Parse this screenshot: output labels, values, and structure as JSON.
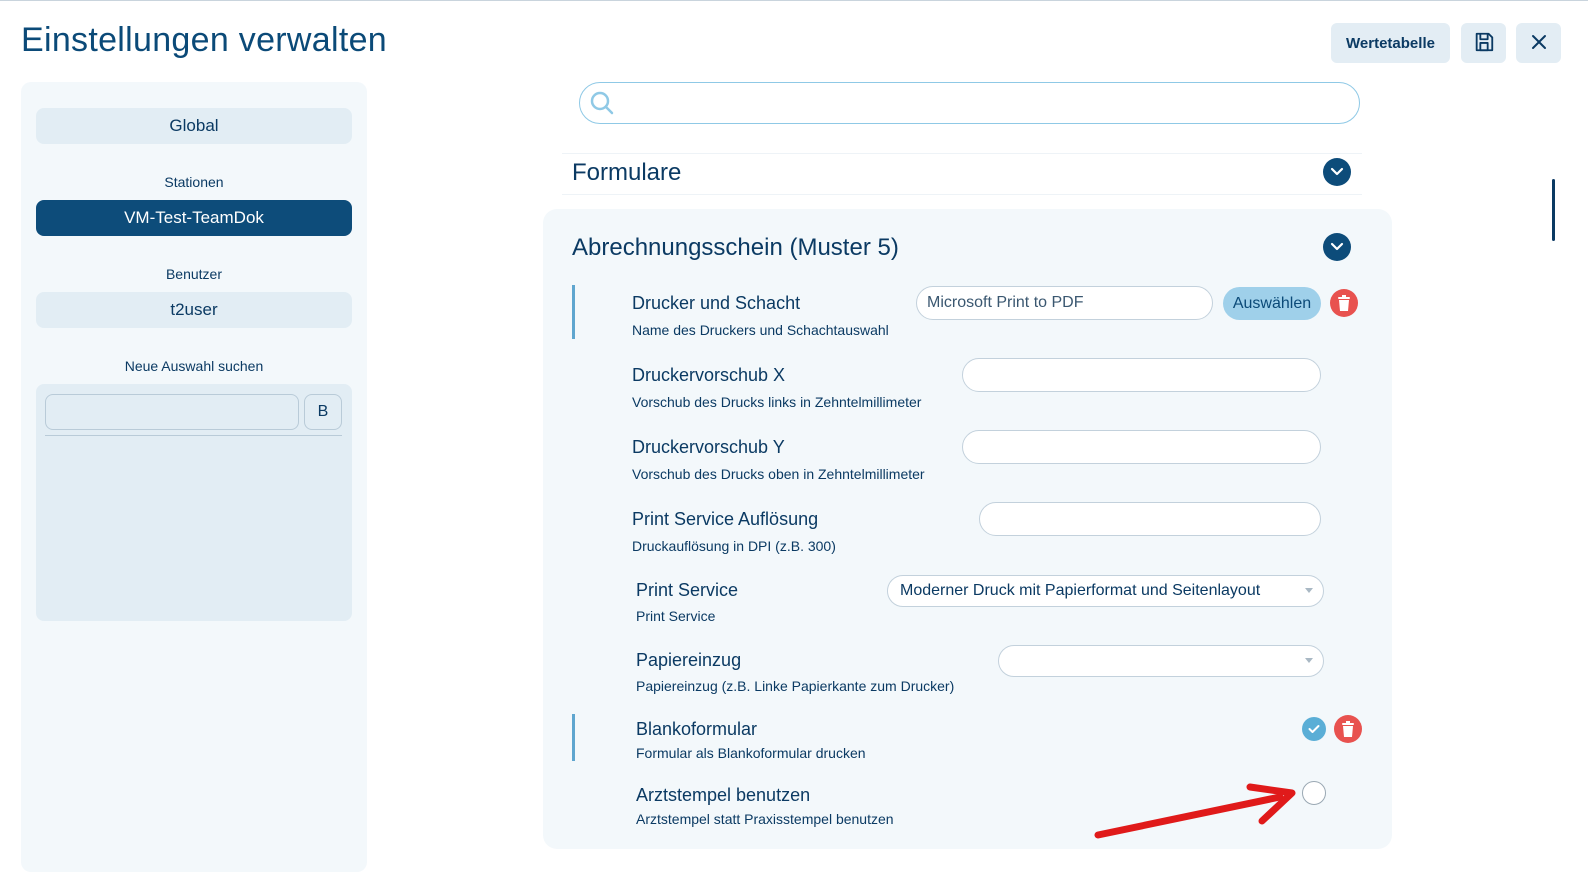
{
  "header": {
    "title": "Einstellungen verwalten",
    "wertetabelle_label": "Wertetabelle",
    "save_icon": "save-icon",
    "close_icon": "close-icon"
  },
  "sidebar": {
    "global_label": "Global",
    "stationen_heading": "Stationen",
    "station_selected": "VM-Test-TeamDok",
    "benutzer_heading": "Benutzer",
    "benutzer_value": "t2user",
    "neue_auswahl_heading": "Neue Auswahl suchen",
    "search_value": "",
    "search_button_label": "B"
  },
  "main": {
    "search": {
      "value": "",
      "icon": "search-icon"
    },
    "section_formulare": "Formulare",
    "panel_title": "Abrechnungsschein (Muster 5)",
    "settings": [
      {
        "label": "Drucker und Schacht",
        "desc": "Name des Druckers und Schachtauswahl",
        "value": "Microsoft Print to PDF",
        "button_label": "Auswählen"
      },
      {
        "label": "Druckervorschub X",
        "desc": "Vorschub des Drucks links in Zehntelmillimeter",
        "value": ""
      },
      {
        "label": "Druckervorschub Y",
        "desc": "Vorschub des Drucks oben in Zehntelmillimeter",
        "value": ""
      },
      {
        "label": "Print Service Auflösung",
        "desc": "Druckauflösung in DPI (z.B. 300)",
        "value": ""
      },
      {
        "label": "Print Service",
        "desc": "Print Service",
        "value": "Moderner Druck mit Papierformat und Seitenlayout"
      },
      {
        "label": "Papiereinzug",
        "desc": "Papiereinzug (z.B. Linke Papierkante zum Drucker)",
        "value": ""
      },
      {
        "label": "Blankoformular",
        "desc": "Formular als Blankoformular drucken",
        "checked": true
      },
      {
        "label": "Arztstempel benutzen",
        "desc": "Arztstempel statt Praxisstempel benutzen",
        "checked": false
      }
    ]
  },
  "colors": {
    "primary": "#0d4c7a",
    "accent": "#5fa6cf",
    "danger": "#e8524f",
    "annotation_arrow": "#e01a1a"
  }
}
